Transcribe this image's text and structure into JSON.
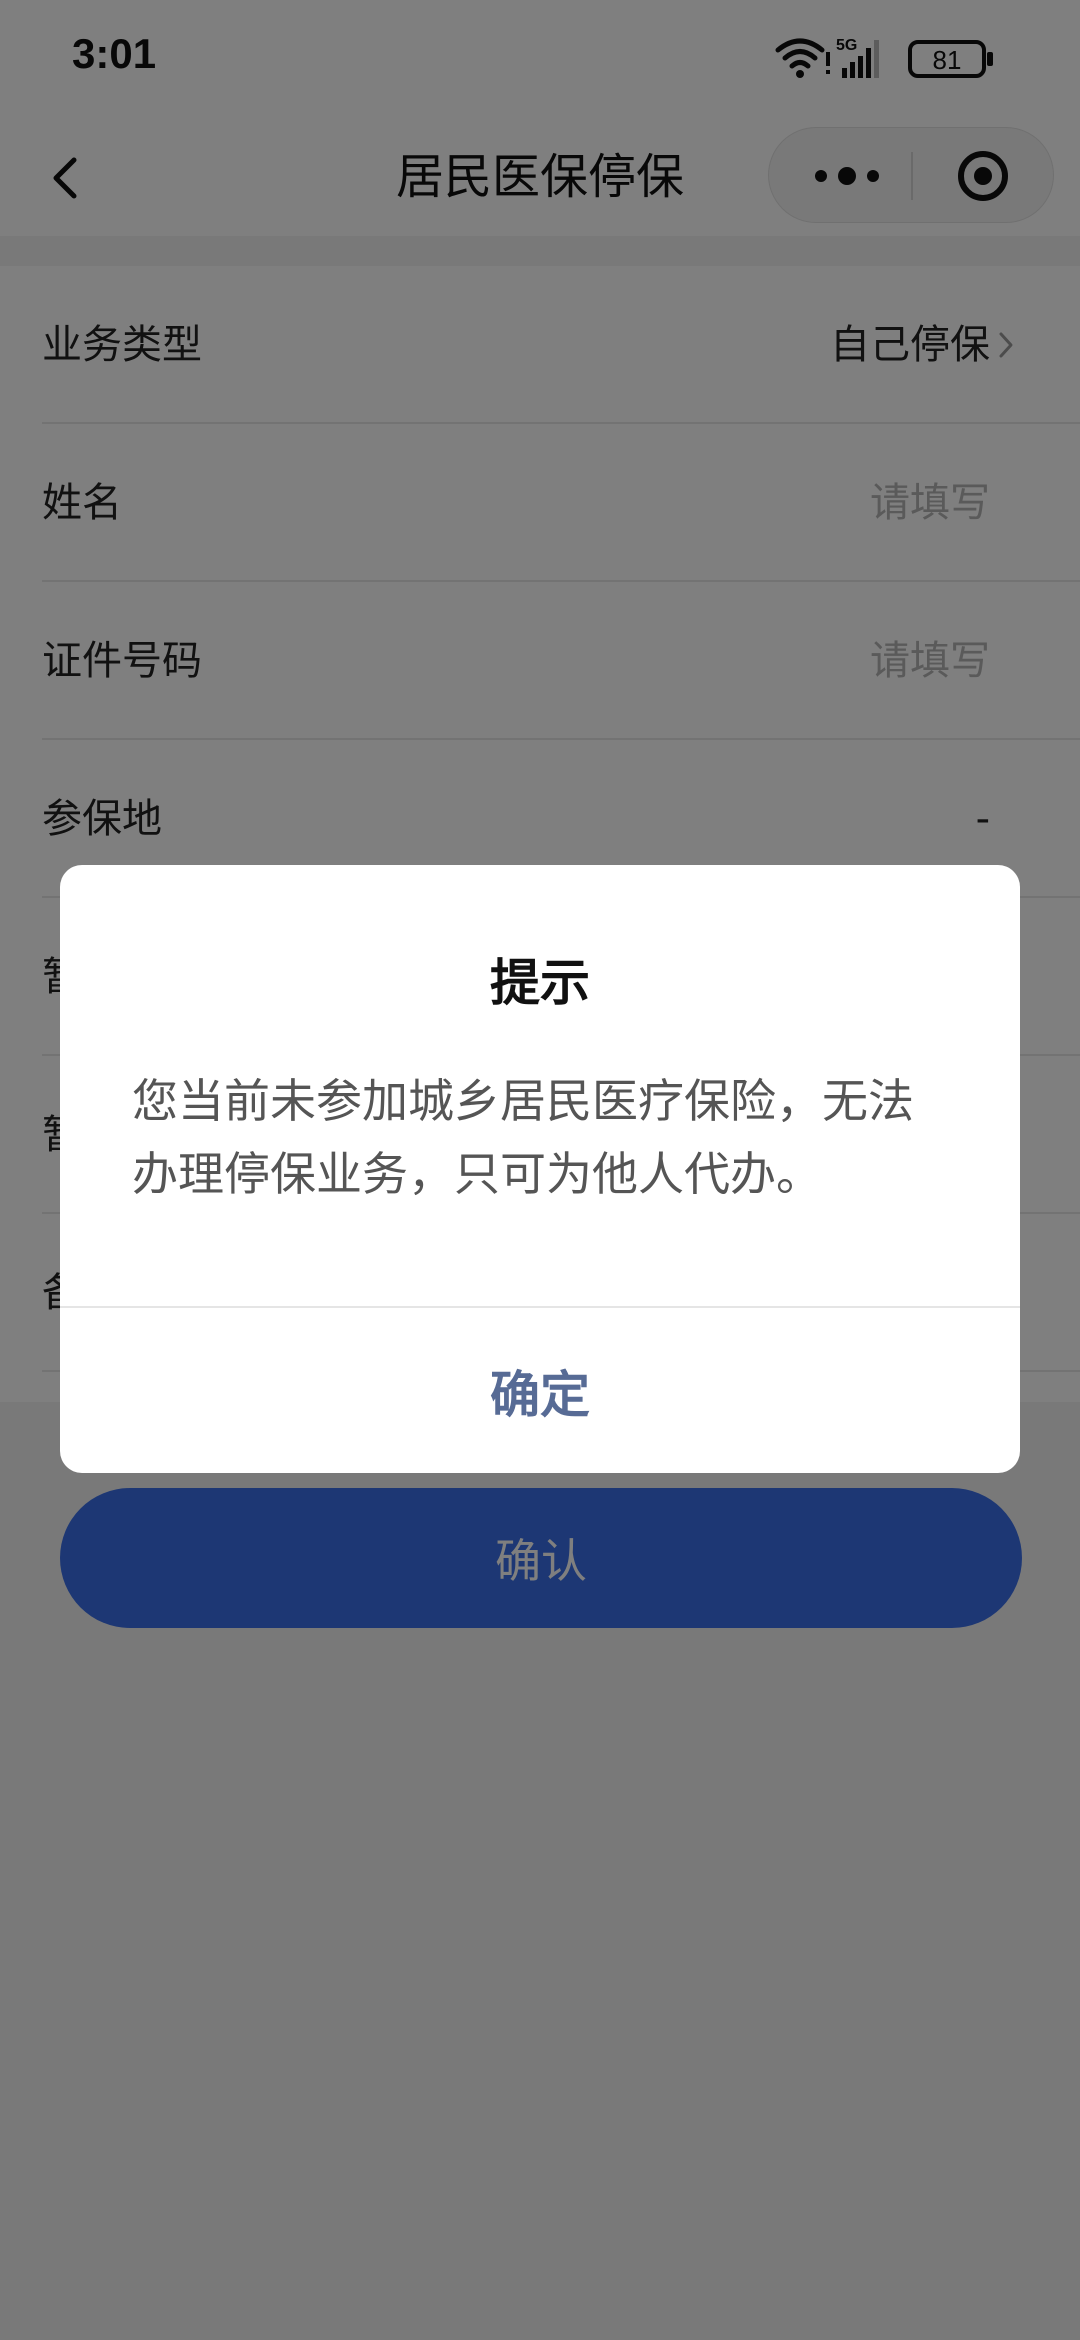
{
  "status_bar": {
    "time": "3:01",
    "network": "5G",
    "battery": "81"
  },
  "nav": {
    "title": "居民医保停保"
  },
  "form": {
    "rows": [
      {
        "label": "业务类型",
        "value": "自己停保"
      },
      {
        "label": "姓名",
        "value": "请填写"
      },
      {
        "label": "证件号码",
        "value": "请填写"
      },
      {
        "label": "参保地",
        "value": "-"
      },
      {
        "label": "暂"
      },
      {
        "label": "暂"
      },
      {
        "label": "备"
      }
    ]
  },
  "confirm_button": {
    "label": "确认"
  },
  "dialog": {
    "title": "提示",
    "message": "您当前未参加城乡居民医疗保险，无法办理停保业务，只可为他人代办。",
    "ok_label": "确定"
  },
  "colors": {
    "primary": "#3a6fe8",
    "dialog_action": "#576b95",
    "mask": "rgba(0,0,0,0.5)"
  }
}
